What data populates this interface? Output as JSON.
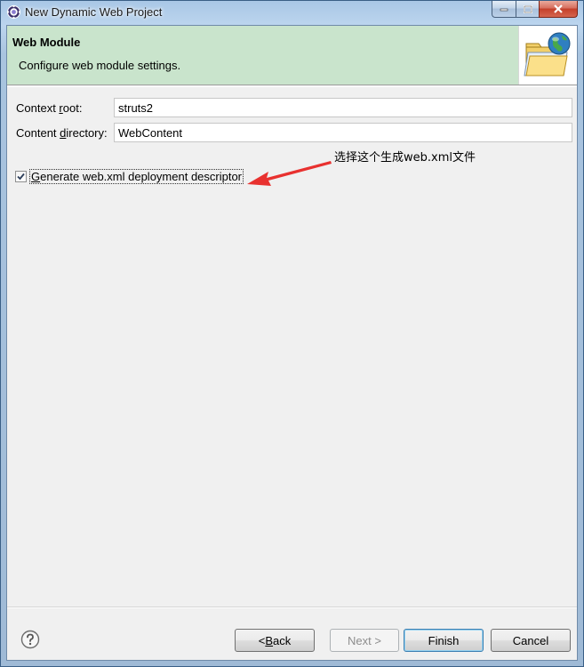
{
  "window": {
    "title": "New Dynamic Web Project"
  },
  "banner": {
    "title": "Web Module",
    "description": "Configure web module settings."
  },
  "form": {
    "context_root": {
      "label_pre": "Context ",
      "label_mnemonic": "r",
      "label_post": "oot:",
      "value": "struts2"
    },
    "content_directory": {
      "label_pre": "Content ",
      "label_mnemonic": "d",
      "label_post": "irectory:",
      "value": "WebContent"
    },
    "generate_descriptor": {
      "label_mnemonic": "G",
      "label_post": "enerate web.xml deployment descriptor",
      "checked": true
    }
  },
  "annotation": {
    "text": "选择这个生成web.xml文件",
    "color": "#e8312f"
  },
  "buttons": {
    "back": {
      "pre": "< ",
      "mnemonic": "B",
      "post": "ack"
    },
    "next": {
      "label": "Next >"
    },
    "finish": {
      "label": "Finish"
    },
    "cancel": {
      "label": "Cancel"
    }
  },
  "colors": {
    "banner_bg": "#c9e4cc",
    "client_bg": "#f0f0f0",
    "close_button": "#c4402a"
  }
}
